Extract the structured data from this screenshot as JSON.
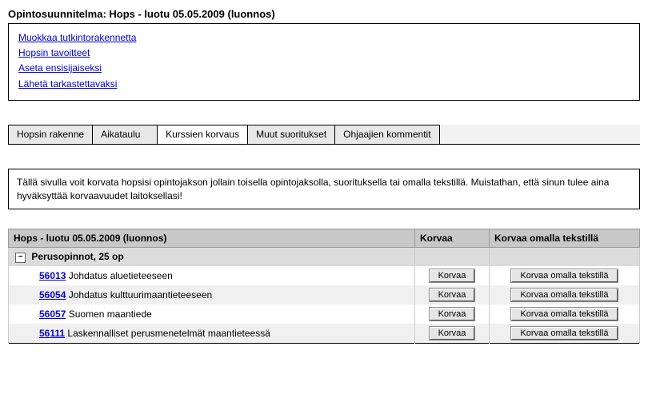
{
  "title": "Opintosuunnitelma: Hops - luotu 05.05.2009 (luonnos)",
  "links": [
    "Muokkaa tutkintorakennetta",
    "Hopsin tavoitteet",
    "Aseta ensisijaiseksi",
    "Lähetä tarkastettavaksi"
  ],
  "tabs": [
    "Hopsin rakenne",
    "Aikataulu",
    "Kurssien korvaus",
    "Muut suoritukset",
    "Ohjaajien kommentit"
  ],
  "active_tab_index": 2,
  "info_text": "Tällä sivulla voit korvata hopsisi opintojakson jollain toisella opintojaksolla, suorituksella tai omalla tekstillä. Muistathan, että sinun tulee aina hyväksyttää korvaavuudet laitoksellasi!",
  "table": {
    "headers": {
      "plan": "Hops - luotu 05.05.2009 (luonnos)",
      "replace": "Korvaa",
      "replace_text": "Korvaa omalla tekstillä"
    },
    "section_label": "Perusopinnot, 25 op",
    "toggle_symbol": "−",
    "button_labels": {
      "replace": "Korvaa",
      "replace_text": "Korvaa omalla tekstillä"
    },
    "courses": [
      {
        "code": "56013",
        "name": "Johdatus aluetieteeseen"
      },
      {
        "code": "56054",
        "name": "Johdatus kulttuurimaantieteeseen"
      },
      {
        "code": "56057",
        "name": "Suomen maantiede"
      },
      {
        "code": "56111",
        "name": "Laskennalliset perusmenetelmät maantieteessä"
      }
    ]
  }
}
